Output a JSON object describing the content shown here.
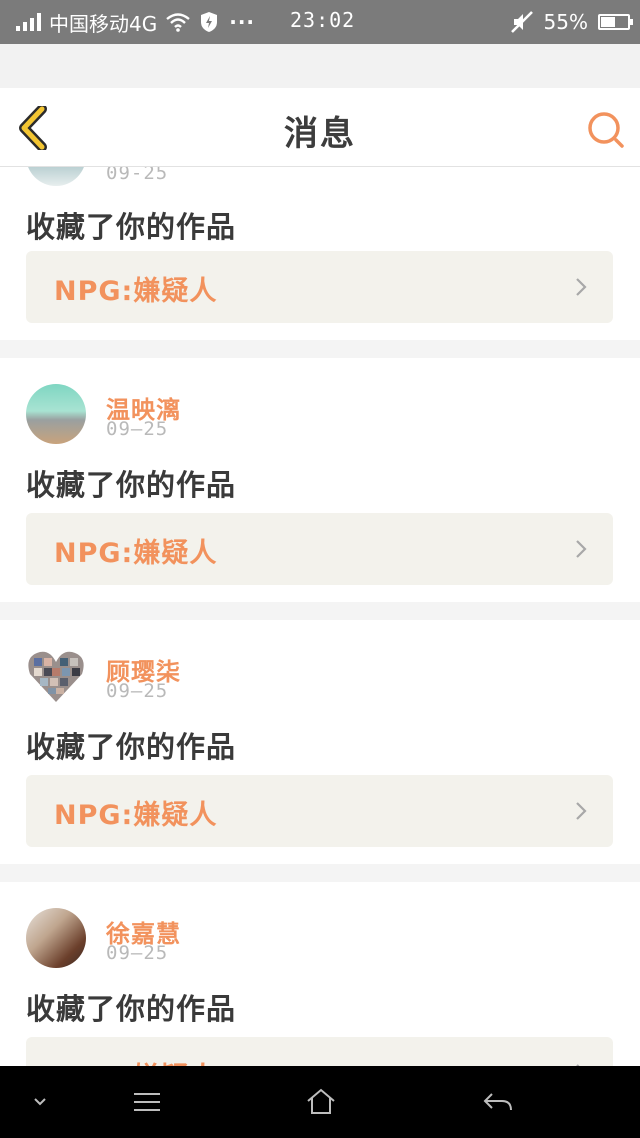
{
  "status_bar": {
    "carrier": "中国移动4G",
    "time": "23:02",
    "battery": "55%",
    "battery_level": 0.55,
    "icons": [
      "signal-icon",
      "wifi-icon",
      "shield-icon",
      "more-icon",
      "mute-icon",
      "battery-icon"
    ]
  },
  "header": {
    "title": "消息",
    "back_icon": "chevron-left-icon",
    "search_icon": "search-icon"
  },
  "feed": [
    {
      "user": "",
      "date": "09-25",
      "action": "收藏了你的作品",
      "work": "NPG:嫌疑人"
    },
    {
      "user": "温映漓",
      "date": "09—25",
      "action": "收藏了你的作品",
      "work": "NPG:嫌疑人"
    },
    {
      "user": "顾璎柒",
      "date": "09—25",
      "action": "收藏了你的作品",
      "work": "NPG:嫌疑人"
    },
    {
      "user": "徐嘉慧",
      "date": "09—25",
      "action": "收藏了你的作品",
      "work": "NPG:嫌疑人"
    }
  ],
  "colors": {
    "accent": "#f2925d",
    "back_icon": "#f3c532",
    "text_dark": "#3a3a3a",
    "card_inner": "#f3f2ec"
  },
  "nav_bar": {
    "icons": [
      "collapse-icon",
      "menu-icon",
      "home-icon",
      "back-arrow-icon"
    ]
  }
}
